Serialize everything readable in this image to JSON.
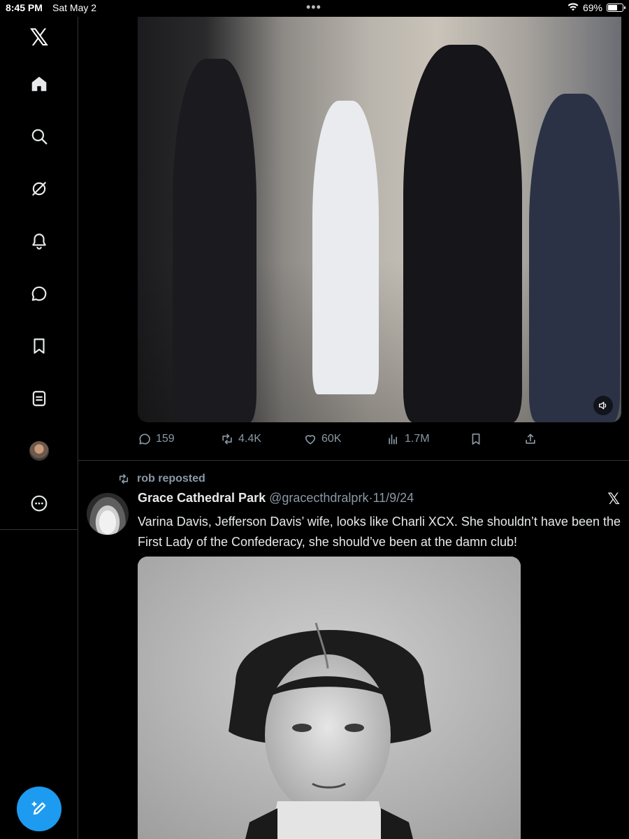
{
  "status_bar": {
    "time": "8:45 PM",
    "date": "Sat May 2",
    "battery": "69%",
    "battery_level": 0.69,
    "wifi_icon": "wifi-icon",
    "more_icon": "more-dots-icon"
  },
  "sidebar": {
    "items": [
      {
        "name": "x-logo",
        "icon": "x-logo-icon"
      },
      {
        "name": "home",
        "icon": "home-icon"
      },
      {
        "name": "explore",
        "icon": "search-icon"
      },
      {
        "name": "grok",
        "icon": "grok-icon"
      },
      {
        "name": "notifications",
        "icon": "bell-icon"
      },
      {
        "name": "messages",
        "icon": "chat-icon"
      },
      {
        "name": "bookmarks",
        "icon": "bookmark-icon"
      },
      {
        "name": "lists",
        "icon": "list-icon"
      },
      {
        "name": "profile",
        "icon": "avatar-icon"
      },
      {
        "name": "more",
        "icon": "more-circle-icon"
      }
    ],
    "logo_text": "𝕏",
    "compose_icon": "compose-icon"
  },
  "post1": {
    "media_icon": "photo-video",
    "sound_icon": "volume-icon",
    "replies": "159",
    "reposts": "4.4K",
    "likes": "60K",
    "views": "1.7M",
    "bookmark_icon": "bookmark-icon",
    "share_icon": "share-icon"
  },
  "post2": {
    "repost_label": "rob reposted",
    "author_name": "Grace Cathedral Park",
    "author_handle": "@gracecthdralprk",
    "separator": "·",
    "date": "11/9/24",
    "source_mark": "𝕏",
    "text": "Varina Davis, Jefferson Davis’ wife, looks like Charli XCX. She shouldn’t have been the First Lady of the Confederacy, she should’ve been at the damn club!"
  },
  "colors": {
    "accent": "#1d9bf0",
    "muted": "#8b98a5",
    "divider": "#2f3336"
  }
}
